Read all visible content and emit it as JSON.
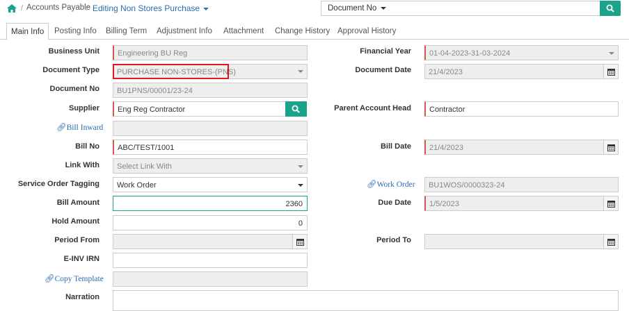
{
  "breadcrumb": {
    "home_icon": "home-icon",
    "items": [
      "Accounts Payable"
    ],
    "current": "Editing Non Stores Purchase"
  },
  "top_search": {
    "doc_type_label": "Document No",
    "value": "",
    "search_icon": "search-icon"
  },
  "tabs": [
    {
      "label": "Main Info",
      "active": true
    },
    {
      "label": "Posting Info"
    },
    {
      "label": "Billing Term"
    },
    {
      "label": "Adjustment Info"
    },
    {
      "label": "Attachment"
    },
    {
      "label": "Change History"
    },
    {
      "label": "Approval History"
    }
  ],
  "form": {
    "business_unit": {
      "label": "Business Unit",
      "value": "Engineering BU Reg"
    },
    "financial_year": {
      "label": "Financial Year",
      "value": "01-04-2023-31-03-2024"
    },
    "document_type": {
      "label": "Document Type",
      "value": "PURCHASE NON-STORES-(PNS)"
    },
    "document_date": {
      "label": "Document Date",
      "value": "21/4/2023"
    },
    "document_no": {
      "label": "Document No",
      "value": "BU1PNS/00001/23-24"
    },
    "supplier": {
      "label": "Supplier",
      "value": "Eng Reg Contractor"
    },
    "parent_account_head": {
      "label": "Parent Account Head",
      "value": "Contractor"
    },
    "bill_inward": {
      "label": "Bill Inward",
      "value": ""
    },
    "bill_no": {
      "label": "Bill No",
      "value": "ABC/TEST/1001"
    },
    "bill_date": {
      "label": "Bill Date",
      "value": "21/4/2023"
    },
    "link_with": {
      "label": "Link With",
      "value": "Select Link With"
    },
    "service_order_tagging": {
      "label": "Service Order Tagging",
      "value": "Work Order"
    },
    "work_order": {
      "label": "Work Order",
      "value": "BU1WOS/0000323-24"
    },
    "bill_amount": {
      "label": "Bill Amount",
      "value": "2360"
    },
    "due_date": {
      "label": "Due Date",
      "value": "1/5/2023"
    },
    "hold_amount": {
      "label": "Hold Amount",
      "value": "0"
    },
    "period_from": {
      "label": "Period From",
      "value": ""
    },
    "period_to": {
      "label": "Period To",
      "value": ""
    },
    "einv_irn": {
      "label": "E-INV IRN",
      "value": ""
    },
    "copy_template": {
      "label": "Copy Template",
      "value": ""
    },
    "narration": {
      "label": "Narration",
      "value": ""
    }
  },
  "colors": {
    "accent": "#1aa38a",
    "link": "#2a6db0",
    "required": "#d9534f",
    "highlight": "#e0161f"
  }
}
